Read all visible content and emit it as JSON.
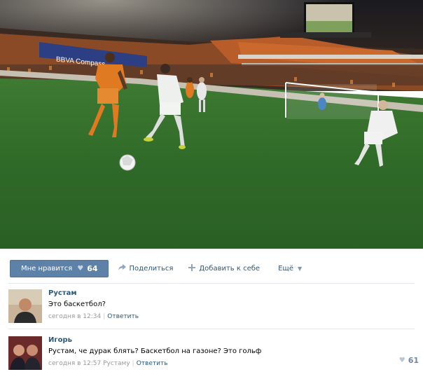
{
  "post": {
    "like_label": "Мне нравится",
    "like_count": "64",
    "share_label": "Поделиться",
    "add_label": "Добавить к себе",
    "more_label": "Ещё"
  },
  "comments": [
    {
      "author": "Рустам",
      "text": "Это баскетбол?",
      "time": "сегодня в 12:34",
      "reply_to": "",
      "reply_label": "Ответить"
    },
    {
      "author": "Игорь",
      "text": "Рустам, че дурак блять? Баскетбол на газоне? Это гольф",
      "time": "сегодня в 12:57",
      "reply_to": "Рустаму",
      "reply_label": "Ответить",
      "likes": "61"
    }
  ],
  "colors": {
    "like_button": "#5e81a8",
    "link": "#2b587a",
    "grass": "#2f6a28",
    "orange_kit": "#e07a22"
  },
  "icons": [
    "heart-icon",
    "share-icon",
    "plus-icon",
    "caret-down-icon"
  ]
}
